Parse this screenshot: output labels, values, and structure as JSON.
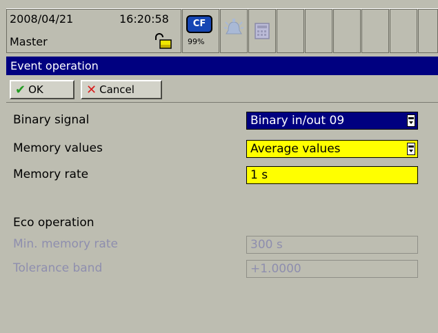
{
  "status": {
    "date": "2008/04/21",
    "time": "16:20:58",
    "user": "Master",
    "storage_label": "CF",
    "storage_percent": "99%"
  },
  "icons": {
    "lock": "unlocked-padlock-icon",
    "alarm": "alarm-bell-icon",
    "calculator": "calculator-icon"
  },
  "colors": {
    "background": "#bdbdb1",
    "title_bar": "#000080",
    "highlight_yellow": "#ffff00",
    "disabled_text": "#8e8eae"
  },
  "window": {
    "title": "Event operation"
  },
  "toolbar": {
    "ok_label": "OK",
    "cancel_label": "Cancel"
  },
  "form": {
    "binary_signal": {
      "label": "Binary signal",
      "value": "Binary in/out 09"
    },
    "memory_values": {
      "label": "Memory values",
      "value": "Average values"
    },
    "memory_rate": {
      "label": "Memory rate",
      "value": "1 s"
    },
    "eco_heading": "Eco operation",
    "min_memory_rate": {
      "label": "Min. memory rate",
      "value": "300 s"
    },
    "tolerance_band": {
      "label": "Tolerance band",
      "value": "+1.0000"
    }
  }
}
